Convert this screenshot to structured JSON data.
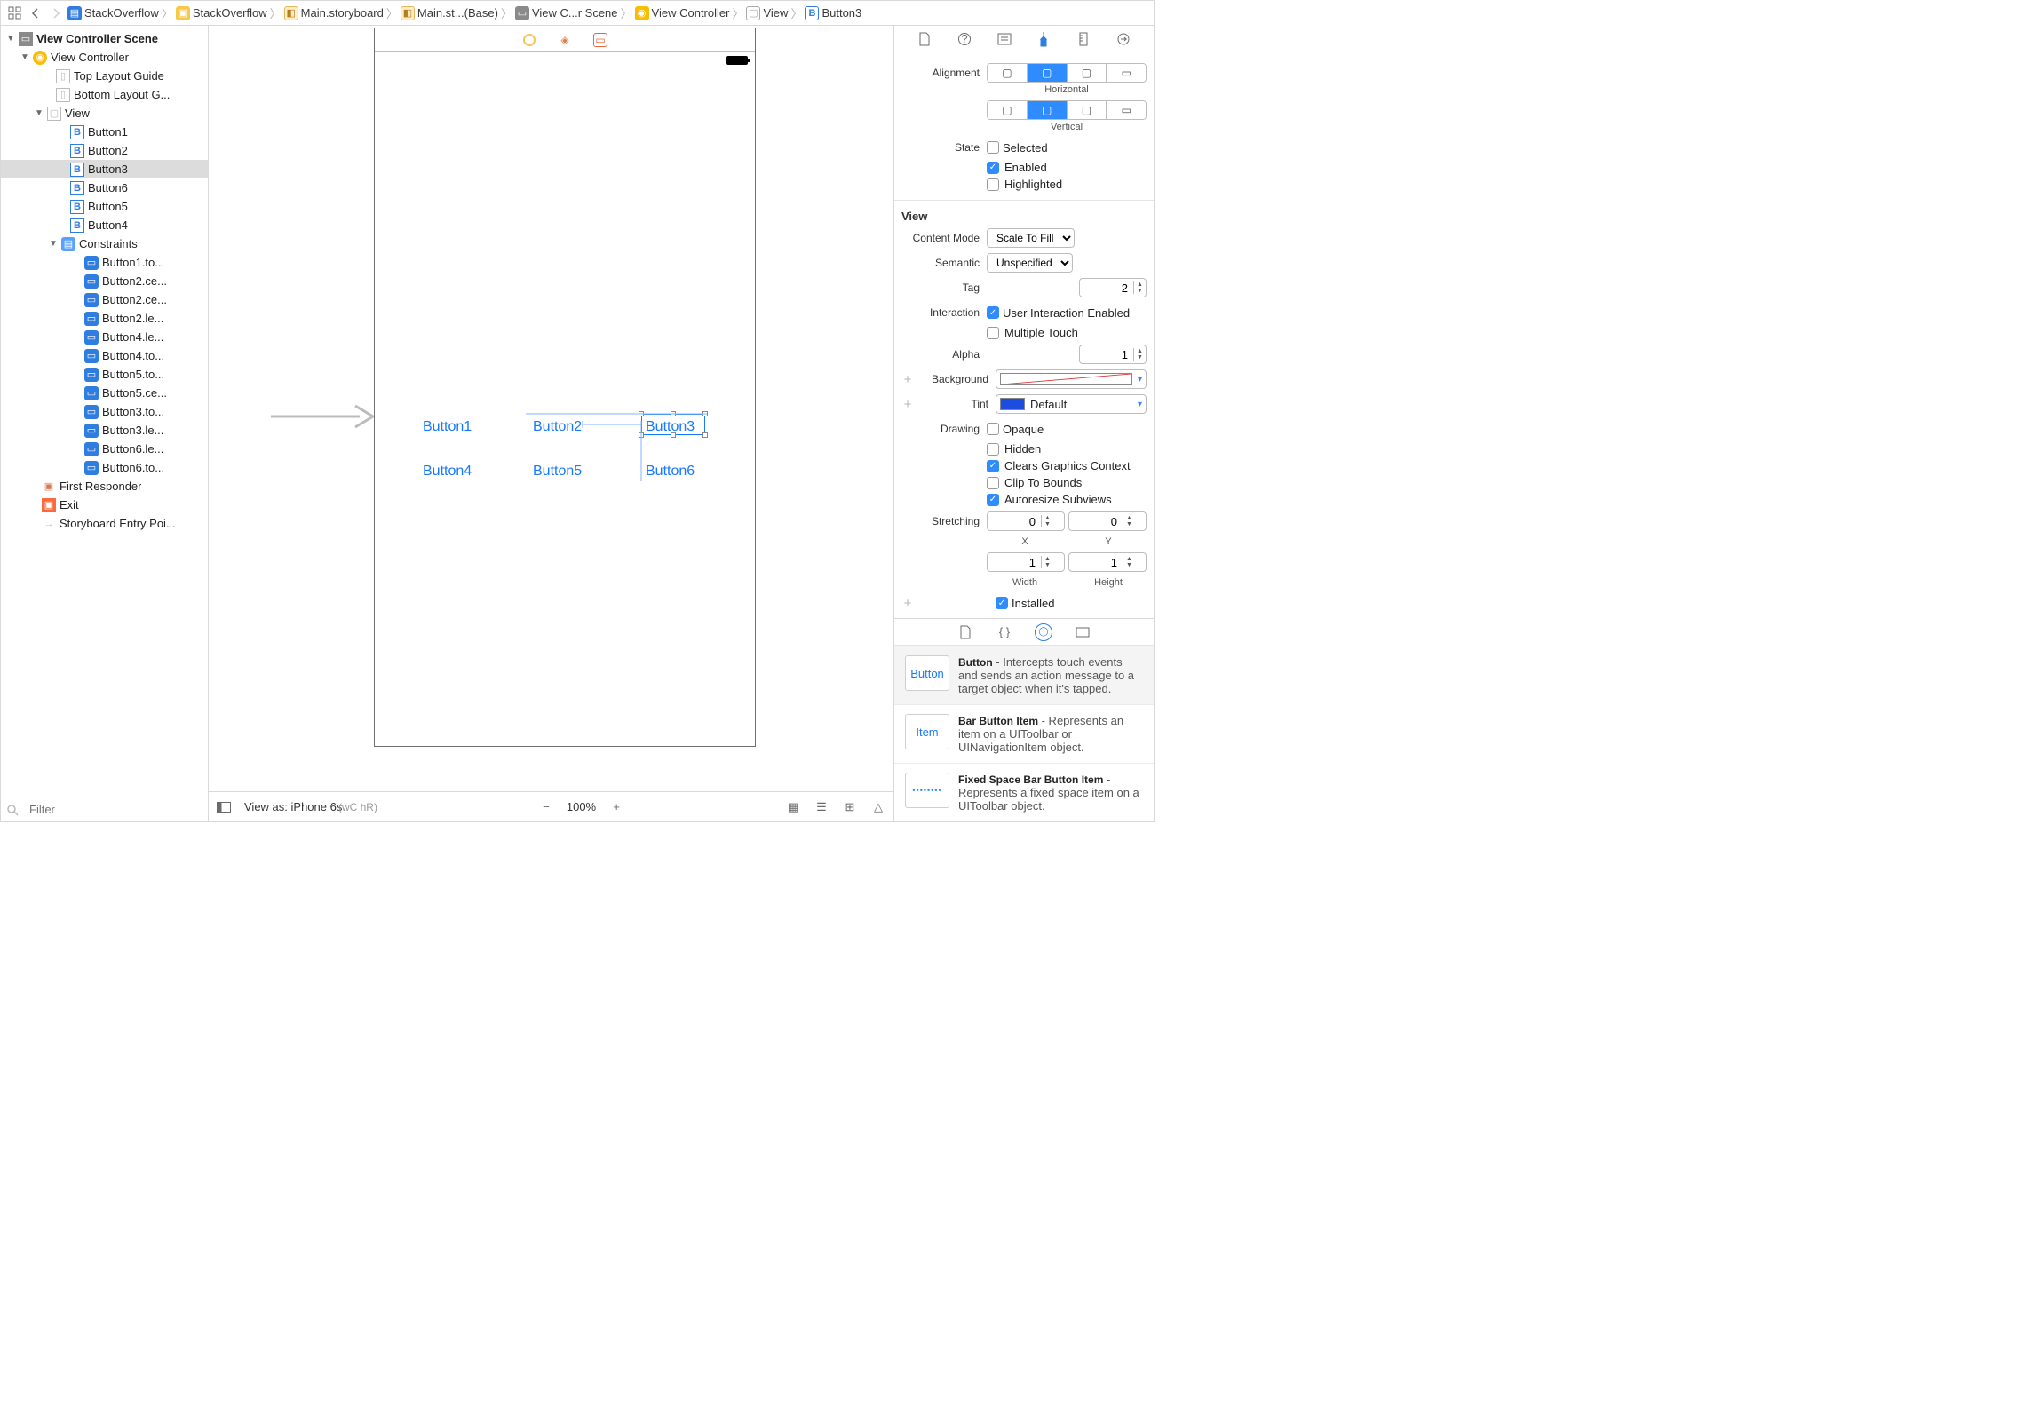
{
  "breadcrumb": [
    {
      "icon": "related",
      "label": ""
    },
    {
      "icon": "blue",
      "label": "StackOverflow"
    },
    {
      "icon": "yel",
      "label": "StackOverflow"
    },
    {
      "icon": "story",
      "label": "Main.storyboard"
    },
    {
      "icon": "story",
      "label": "Main.st...(Base)"
    },
    {
      "icon": "grey",
      "label": "View C...r Scene"
    },
    {
      "icon": "yelcirc",
      "label": "View Controller"
    },
    {
      "icon": "white",
      "label": "View"
    },
    {
      "icon": "b",
      "label": "Button3"
    }
  ],
  "outline": {
    "scene_title": "View Controller Scene",
    "vc": "View Controller",
    "top_guide": "Top Layout Guide",
    "bottom_guide": "Bottom Layout G...",
    "view": "View",
    "buttons": [
      "Button1",
      "Button2",
      "Button3",
      "Button6",
      "Button5",
      "Button4"
    ],
    "constraints_label": "Constraints",
    "constraints": [
      "Button1.to...",
      "Button2.ce...",
      "Button2.ce...",
      "Button2.le...",
      "Button4.le...",
      "Button4.to...",
      "Button5.to...",
      "Button5.ce...",
      "Button3.to...",
      "Button3.le...",
      "Button6.le...",
      "Button6.to..."
    ],
    "first_responder": "First Responder",
    "exit": "Exit",
    "entry": "Storyboard Entry Poi...",
    "filter_placeholder": "Filter"
  },
  "canvas": {
    "buttons": {
      "b1": "Button1",
      "b2": "Button2",
      "b3": "Button3",
      "b4": "Button4",
      "b5": "Button5",
      "b6": "Button6"
    }
  },
  "bottombar": {
    "view_as": "View as: iPhone 6s",
    "size_classes": "(wC hR)",
    "zoom": "100%"
  },
  "inspector": {
    "alignment": {
      "label": "Alignment",
      "horizontal": "Horizontal",
      "vertical": "Vertical"
    },
    "state": {
      "label": "State",
      "selected": "Selected",
      "enabled": "Enabled",
      "highlighted": "Highlighted"
    },
    "view_section": "View",
    "content_mode": {
      "label": "Content Mode",
      "value": "Scale To Fill"
    },
    "semantic": {
      "label": "Semantic",
      "value": "Unspecified"
    },
    "tag": {
      "label": "Tag",
      "value": "2"
    },
    "interaction": {
      "label": "Interaction",
      "user": "User Interaction Enabled",
      "multi": "Multiple Touch"
    },
    "alpha": {
      "label": "Alpha",
      "value": "1"
    },
    "background": {
      "label": "Background"
    },
    "tint": {
      "label": "Tint",
      "value": "Default"
    },
    "drawing": {
      "label": "Drawing",
      "opaque": "Opaque",
      "hidden": "Hidden",
      "clears": "Clears Graphics Context",
      "clip": "Clip To Bounds",
      "autoresize": "Autoresize Subviews"
    },
    "stretching": {
      "label": "Stretching",
      "x": "0",
      "y": "0",
      "w": "1",
      "h": "1",
      "xl": "X",
      "yl": "Y",
      "wl": "Width",
      "hl": "Height"
    },
    "installed": "Installed"
  },
  "library": {
    "button": {
      "title": "Button",
      "desc": " - Intercepts touch events and sends an action message to a target object when it's tapped.",
      "thumb": "Button"
    },
    "bar": {
      "title": "Bar Button Item",
      "desc": " - Represents an item on a UIToolbar or UINavigationItem object.",
      "thumb": "Item"
    },
    "fixed": {
      "title": "Fixed Space Bar Button Item",
      "desc": " - Represents a fixed space item on a UIToolbar object."
    }
  }
}
